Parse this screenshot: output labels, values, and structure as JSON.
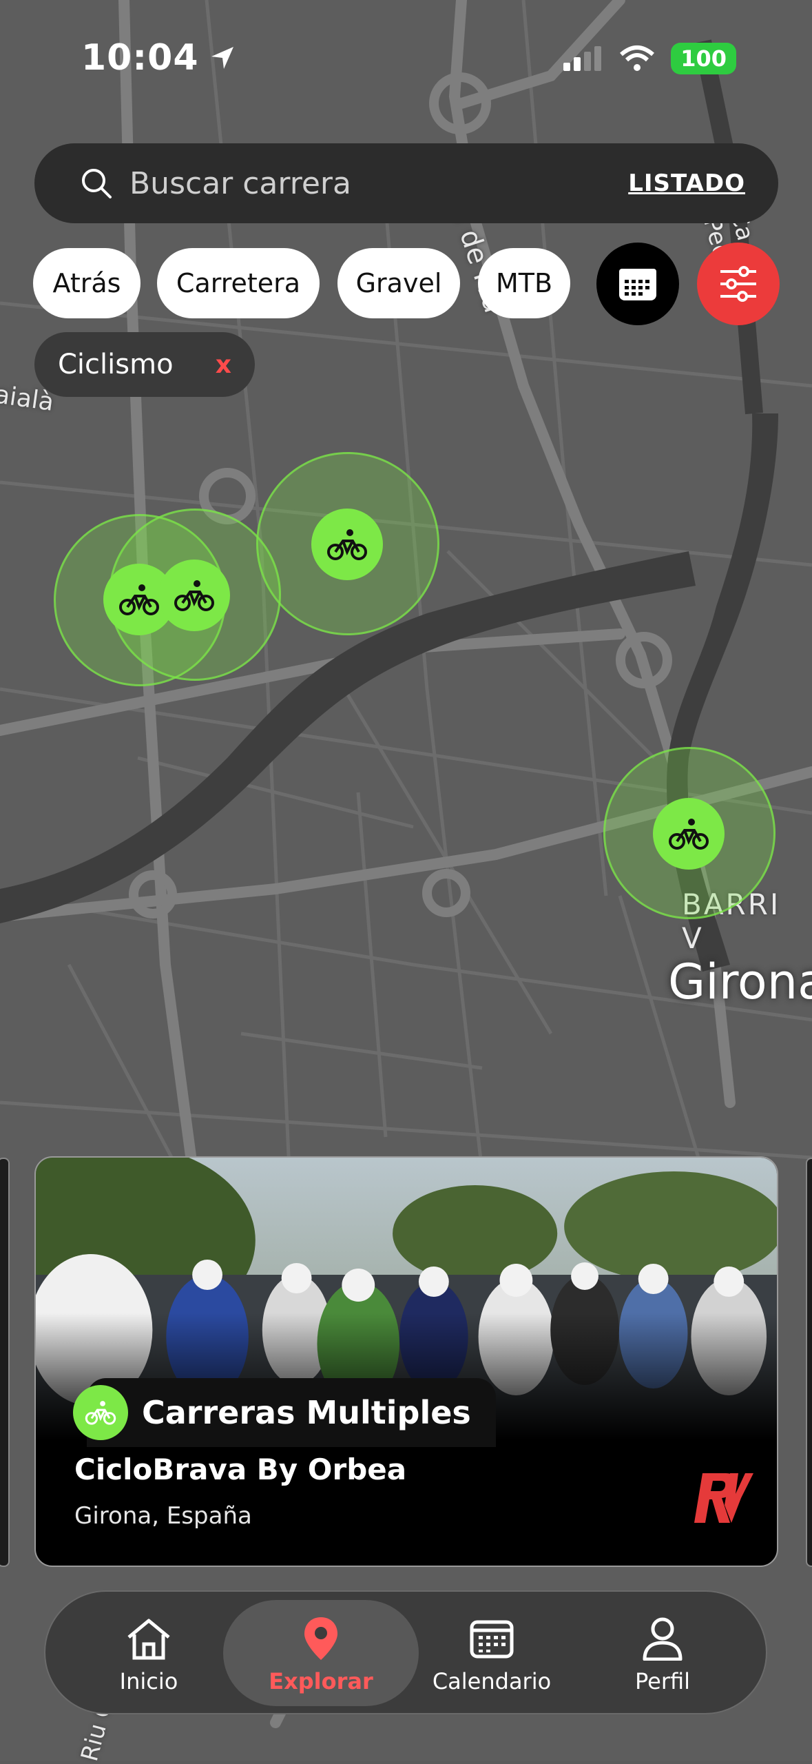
{
  "status": {
    "time": "10:04",
    "battery": "100"
  },
  "search": {
    "placeholder": "Buscar carrera",
    "list_label": "LISTADO"
  },
  "filters": {
    "chips": [
      "Atrás",
      "Carretera",
      "Gravel",
      "MTB"
    ],
    "active_filter": {
      "label": "Ciclismo",
      "remove": "x"
    }
  },
  "map": {
    "streets": [
      "Av. de Fra",
      "Ca   s Pedret",
      "aialà"
    ],
    "neighborhood": "BARRI V",
    "city": "Girona",
    "bottom_street": "Riu O"
  },
  "card": {
    "category": "Carreras Multiples",
    "title": "CicloBrava By Orbea",
    "location": "Girona, España",
    "logo": "RK"
  },
  "nav": {
    "items": [
      {
        "label": "Inicio",
        "icon": "home-icon"
      },
      {
        "label": "Explorar",
        "icon": "map-pin-icon"
      },
      {
        "label": "Calendario",
        "icon": "calendar-icon"
      },
      {
        "label": "Perfil",
        "icon": "user-icon"
      }
    ],
    "active": "Explorar"
  },
  "colors": {
    "accent_green": "#7de847",
    "accent_red": "#ff4b4b",
    "surface": "#2c2c2c"
  }
}
